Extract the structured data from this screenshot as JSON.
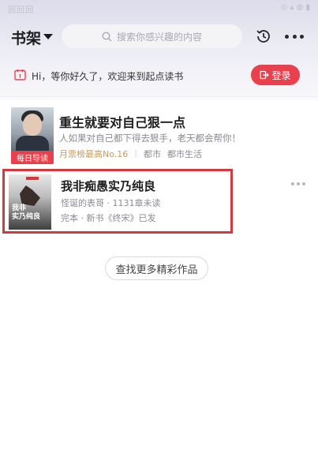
{
  "status_bar": {
    "left": "回回回",
    "right": "◎ ▴ ◍ ▮"
  },
  "header": {
    "title": "书架",
    "search_placeholder": "搜索你感兴趣的内容"
  },
  "welcome": {
    "text": "Hi，等你好久了，欢迎来到起点读书",
    "login_label": "登录"
  },
  "books": [
    {
      "title": "重生就要对自己狠一点",
      "description": "人如果对自己都下得去狠手，老天都会帮你！",
      "badge": "每日导读",
      "rank": "月票榜最高No.16",
      "tags": [
        "都市",
        "都市生活"
      ]
    },
    {
      "title": "我非痴愚实乃纯良",
      "meta_line1": "怪诞的表哥 · 1131章未读",
      "meta_line2": "完本 · 新书《终宋》已发",
      "cover_text": "我非痴愚实乃纯良",
      "cover_text_line1": "我非",
      "cover_text_line2": "实乃纯良"
    }
  ],
  "find_more_label": "查找更多精彩作品",
  "colors": {
    "accent": "#e9404d",
    "highlight_border": "#d33a3f",
    "rank": "#c89b5a"
  }
}
